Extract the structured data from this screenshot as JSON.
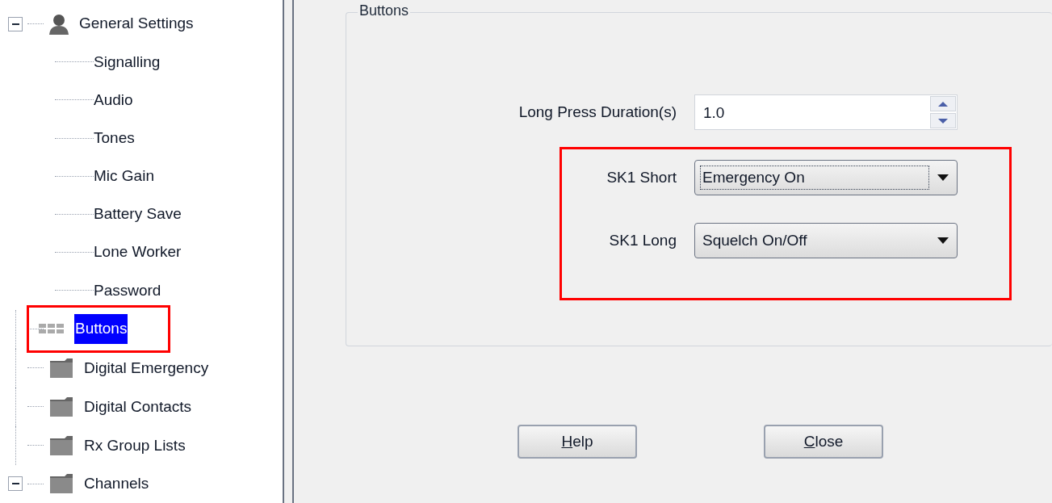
{
  "tree": [
    {
      "label": "General Settings",
      "kind": "person",
      "expanded": true,
      "selected": false,
      "highlighted": false,
      "children": [
        {
          "label": "Signalling"
        },
        {
          "label": "Audio"
        },
        {
          "label": "Tones"
        },
        {
          "label": "Mic Gain"
        },
        {
          "label": "Battery Save"
        },
        {
          "label": "Lone Worker"
        },
        {
          "label": "Password"
        }
      ]
    },
    {
      "label": "Buttons",
      "kind": "grid",
      "selected": true,
      "highlighted": true
    },
    {
      "label": "Digital Emergency",
      "kind": "folder",
      "selected": false,
      "highlighted": false
    },
    {
      "label": "Digital Contacts",
      "kind": "folder",
      "selected": false,
      "highlighted": false
    },
    {
      "label": "Rx Group Lists",
      "kind": "folder",
      "selected": false,
      "highlighted": false
    },
    {
      "label": "Channels",
      "kind": "folder",
      "expanded": true,
      "selected": false,
      "highlighted": false
    }
  ],
  "group": {
    "title": "Buttons",
    "duration": {
      "label": "Long Press Duration(s)",
      "value": "1.0"
    },
    "shortcuts_highlighted": true,
    "shortcuts": [
      {
        "label": "SK1 Short",
        "value": "Emergency On",
        "focused": true
      },
      {
        "label": "SK1 Long",
        "value": "Squelch On/Off",
        "focused": false
      }
    ]
  },
  "buttons": [
    {
      "label": "Help",
      "underline_first": true
    },
    {
      "label": "Close",
      "underline_first": true
    }
  ]
}
